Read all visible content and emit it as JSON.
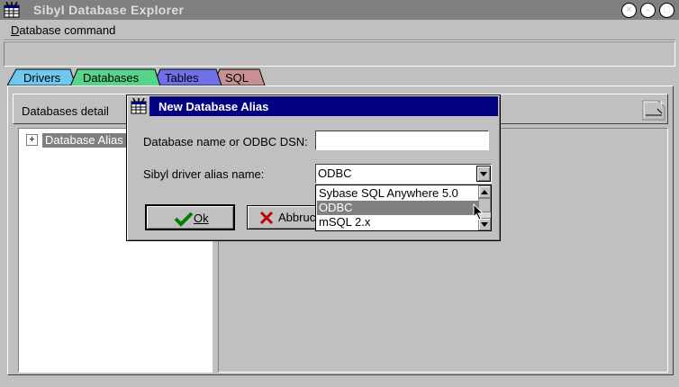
{
  "window": {
    "title": "Sibyl Database Explorer",
    "icon": "database-app-icon",
    "controls": {
      "close": "×",
      "minimize": "-",
      "maximize": "□"
    }
  },
  "menu": {
    "items": [
      "Database command"
    ]
  },
  "tabs": [
    {
      "label": "Drivers",
      "color": "#6ec8f0"
    },
    {
      "label": "Databases",
      "color": "#55d48a"
    },
    {
      "label": "Tables",
      "color": "#7070e8"
    },
    {
      "label": "SQL",
      "color": "#c89090"
    }
  ],
  "panel": {
    "header": "Databases detail",
    "tree": {
      "expander": "+",
      "root": "Database Alias"
    }
  },
  "dialog": {
    "title": "New Database Alias",
    "name_label": "Database name or ODBC DSN:",
    "name_value": "",
    "driver_label": "Sibyl driver alias name:",
    "driver_value": "ODBC",
    "driver_options": [
      "Sybase SQL Anywhere 5.0",
      "ODBC",
      "mSQL 2.x"
    ],
    "selected_index": 1,
    "ok_label": "Ok",
    "cancel_label": "Abbruch"
  },
  "colors": {
    "titlebar": "#808080",
    "dialog_titlebar": "#000080",
    "selection": "#808080",
    "ok_check": "#008000",
    "cancel_x": "#c00000"
  }
}
